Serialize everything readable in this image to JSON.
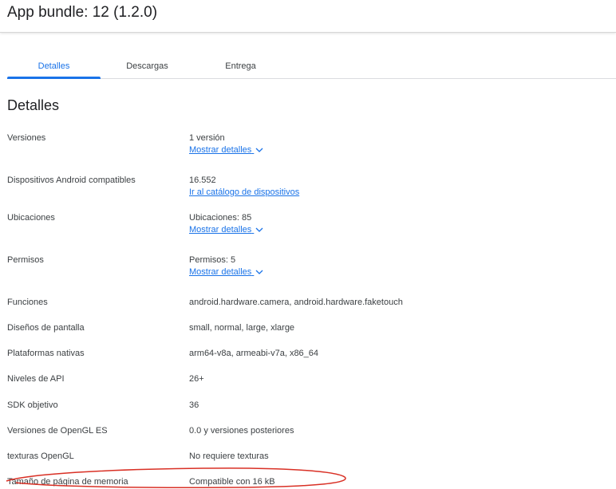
{
  "header": {
    "title": "App bundle: 12 (1.2.0)"
  },
  "tabs": [
    {
      "label": "Detalles",
      "active": true
    },
    {
      "label": "Descargas",
      "active": false
    },
    {
      "label": "Entrega",
      "active": false
    }
  ],
  "section": {
    "title": "Detalles"
  },
  "rows": [
    {
      "label": "Versiones",
      "value": "1 versión",
      "link": "Mostrar detalles"
    },
    {
      "label": "Dispositivos Android compatibles",
      "value": "16.552",
      "link": "Ir al catálogo de dispositivos"
    },
    {
      "label": "Ubicaciones",
      "value": "Ubicaciones: 85",
      "link": "Mostrar detalles"
    },
    {
      "label": "Permisos",
      "value": "Permisos: 5",
      "link": "Mostrar detalles"
    },
    {
      "label": "Funciones",
      "value": "android.hardware.camera, android.hardware.faketouch"
    },
    {
      "label": "Diseños de pantalla",
      "value": "small, normal, large, xlarge"
    },
    {
      "label": "Plataformas nativas",
      "value": "arm64-v8a, armeabi-v7a, x86_64"
    },
    {
      "label": "Niveles de API",
      "value": "26+"
    },
    {
      "label": "SDK objetivo",
      "value": "36"
    },
    {
      "label": "Versiones de OpenGL ES",
      "value": "0.0 y versiones posteriores"
    },
    {
      "label": "texturas OpenGL",
      "value": "No requiere texturas"
    },
    {
      "label": "Tamaño de página de memoria",
      "value": "Compatible con 16 kB"
    }
  ],
  "icons": {
    "expand": "chevron-down-icon"
  },
  "colors": {
    "accent": "#1a73e8",
    "annotation": "#d93025",
    "text": "#3c4043"
  }
}
